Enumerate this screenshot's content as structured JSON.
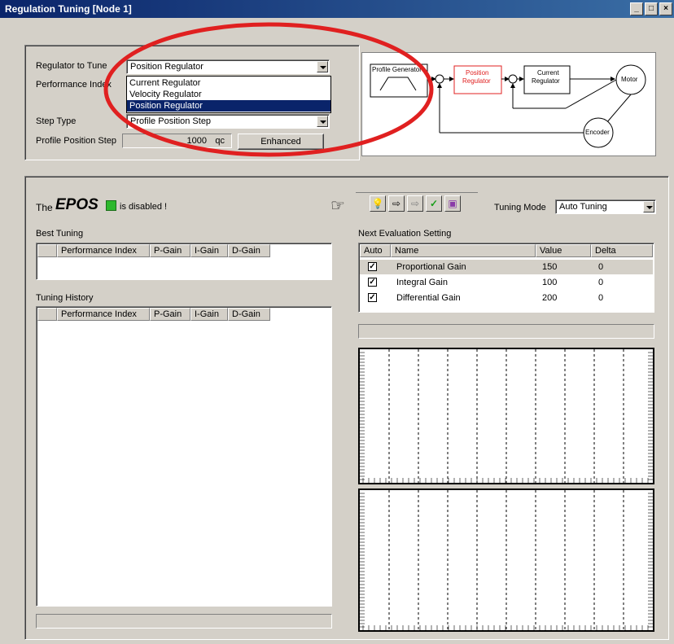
{
  "window": {
    "title": "Regulation Tuning [Node 1]",
    "buttons": [
      "_",
      "□",
      "×"
    ]
  },
  "regulator": {
    "label_tune": "Regulator to Tune",
    "selected": "Position Regulator",
    "label_performance": "Performance Index",
    "options": [
      "Current Regulator",
      "Velocity Regulator",
      "Position Regulator"
    ],
    "label_step_type": "Step Type",
    "step_type_value": "Profile Position Step",
    "label_profile_step": "Profile Position Step",
    "profile_step_value": "1000",
    "profile_step_unit": "qc",
    "enhanced_button": "Enhanced"
  },
  "diagram": {
    "profile_generator": "Profile Generator",
    "position_regulator_1": "Position",
    "position_regulator_2": "Regulator",
    "current_regulator_1": "Current",
    "current_regulator_2": "Regulator",
    "motor": "Motor",
    "encoder": "Encoder",
    "colors": {
      "highlight": "#e02020"
    }
  },
  "status": {
    "the": "The",
    "epos": "EPOS",
    "disabled": "is disabled !",
    "led_color": "#2db82d"
  },
  "toolbar": {
    "icons": [
      "pointing-hand-icon",
      "lightbulb-icon",
      "arrow-right-icon",
      "arrow-right-disabled-icon",
      "checkmark-icon",
      "book-icon"
    ]
  },
  "tuning_mode": {
    "label": "Tuning Mode",
    "value": "Auto Tuning"
  },
  "best_tuning": {
    "label": "Best Tuning",
    "columns": [
      "",
      "Performance Index",
      "P-Gain",
      "I-Gain",
      "D-Gain"
    ]
  },
  "tuning_history": {
    "label": "Tuning History",
    "columns": [
      "",
      "Performance Index",
      "P-Gain",
      "I-Gain",
      "D-Gain"
    ]
  },
  "next_eval": {
    "label": "Next Evaluation Setting",
    "columns": [
      "Auto",
      "Name",
      "Value",
      "Delta"
    ],
    "rows": [
      {
        "checked": true,
        "name": "Proportional Gain",
        "value": "150",
        "delta": "0"
      },
      {
        "checked": true,
        "name": "Integral Gain",
        "value": "100",
        "delta": "0"
      },
      {
        "checked": true,
        "name": "Differential Gain",
        "value": "200",
        "delta": "0"
      }
    ]
  },
  "annotation": {
    "ellipse_color": "#e02020"
  }
}
